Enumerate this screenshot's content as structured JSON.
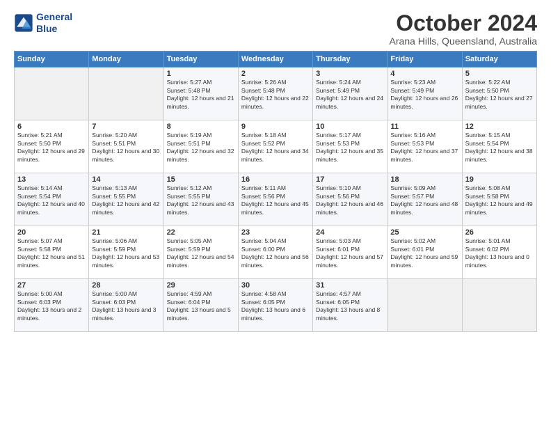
{
  "header": {
    "logo_line1": "General",
    "logo_line2": "Blue",
    "title": "October 2024",
    "subtitle": "Arana Hills, Queensland, Australia"
  },
  "weekdays": [
    "Sunday",
    "Monday",
    "Tuesday",
    "Wednesday",
    "Thursday",
    "Friday",
    "Saturday"
  ],
  "weeks": [
    [
      {
        "day": "",
        "empty": true
      },
      {
        "day": "",
        "empty": true
      },
      {
        "day": "1",
        "sunrise": "5:27 AM",
        "sunset": "5:48 PM",
        "daylight": "12 hours and 21 minutes."
      },
      {
        "day": "2",
        "sunrise": "5:26 AM",
        "sunset": "5:48 PM",
        "daylight": "12 hours and 22 minutes."
      },
      {
        "day": "3",
        "sunrise": "5:24 AM",
        "sunset": "5:49 PM",
        "daylight": "12 hours and 24 minutes."
      },
      {
        "day": "4",
        "sunrise": "5:23 AM",
        "sunset": "5:49 PM",
        "daylight": "12 hours and 26 minutes."
      },
      {
        "day": "5",
        "sunrise": "5:22 AM",
        "sunset": "5:50 PM",
        "daylight": "12 hours and 27 minutes."
      }
    ],
    [
      {
        "day": "6",
        "sunrise": "5:21 AM",
        "sunset": "5:50 PM",
        "daylight": "12 hours and 29 minutes."
      },
      {
        "day": "7",
        "sunrise": "5:20 AM",
        "sunset": "5:51 PM",
        "daylight": "12 hours and 30 minutes."
      },
      {
        "day": "8",
        "sunrise": "5:19 AM",
        "sunset": "5:51 PM",
        "daylight": "12 hours and 32 minutes."
      },
      {
        "day": "9",
        "sunrise": "5:18 AM",
        "sunset": "5:52 PM",
        "daylight": "12 hours and 34 minutes."
      },
      {
        "day": "10",
        "sunrise": "5:17 AM",
        "sunset": "5:53 PM",
        "daylight": "12 hours and 35 minutes."
      },
      {
        "day": "11",
        "sunrise": "5:16 AM",
        "sunset": "5:53 PM",
        "daylight": "12 hours and 37 minutes."
      },
      {
        "day": "12",
        "sunrise": "5:15 AM",
        "sunset": "5:54 PM",
        "daylight": "12 hours and 38 minutes."
      }
    ],
    [
      {
        "day": "13",
        "sunrise": "5:14 AM",
        "sunset": "5:54 PM",
        "daylight": "12 hours and 40 minutes."
      },
      {
        "day": "14",
        "sunrise": "5:13 AM",
        "sunset": "5:55 PM",
        "daylight": "12 hours and 42 minutes."
      },
      {
        "day": "15",
        "sunrise": "5:12 AM",
        "sunset": "5:55 PM",
        "daylight": "12 hours and 43 minutes."
      },
      {
        "day": "16",
        "sunrise": "5:11 AM",
        "sunset": "5:56 PM",
        "daylight": "12 hours and 45 minutes."
      },
      {
        "day": "17",
        "sunrise": "5:10 AM",
        "sunset": "5:56 PM",
        "daylight": "12 hours and 46 minutes."
      },
      {
        "day": "18",
        "sunrise": "5:09 AM",
        "sunset": "5:57 PM",
        "daylight": "12 hours and 48 minutes."
      },
      {
        "day": "19",
        "sunrise": "5:08 AM",
        "sunset": "5:58 PM",
        "daylight": "12 hours and 49 minutes."
      }
    ],
    [
      {
        "day": "20",
        "sunrise": "5:07 AM",
        "sunset": "5:58 PM",
        "daylight": "12 hours and 51 minutes."
      },
      {
        "day": "21",
        "sunrise": "5:06 AM",
        "sunset": "5:59 PM",
        "daylight": "12 hours and 53 minutes."
      },
      {
        "day": "22",
        "sunrise": "5:05 AM",
        "sunset": "5:59 PM",
        "daylight": "12 hours and 54 minutes."
      },
      {
        "day": "23",
        "sunrise": "5:04 AM",
        "sunset": "6:00 PM",
        "daylight": "12 hours and 56 minutes."
      },
      {
        "day": "24",
        "sunrise": "5:03 AM",
        "sunset": "6:01 PM",
        "daylight": "12 hours and 57 minutes."
      },
      {
        "day": "25",
        "sunrise": "5:02 AM",
        "sunset": "6:01 PM",
        "daylight": "12 hours and 59 minutes."
      },
      {
        "day": "26",
        "sunrise": "5:01 AM",
        "sunset": "6:02 PM",
        "daylight": "13 hours and 0 minutes."
      }
    ],
    [
      {
        "day": "27",
        "sunrise": "5:00 AM",
        "sunset": "6:03 PM",
        "daylight": "13 hours and 2 minutes."
      },
      {
        "day": "28",
        "sunrise": "5:00 AM",
        "sunset": "6:03 PM",
        "daylight": "13 hours and 3 minutes."
      },
      {
        "day": "29",
        "sunrise": "4:59 AM",
        "sunset": "6:04 PM",
        "daylight": "13 hours and 5 minutes."
      },
      {
        "day": "30",
        "sunrise": "4:58 AM",
        "sunset": "6:05 PM",
        "daylight": "13 hours and 6 minutes."
      },
      {
        "day": "31",
        "sunrise": "4:57 AM",
        "sunset": "6:05 PM",
        "daylight": "13 hours and 8 minutes."
      },
      {
        "day": "",
        "empty": true
      },
      {
        "day": "",
        "empty": true
      }
    ]
  ],
  "labels": {
    "sunrise": "Sunrise:",
    "sunset": "Sunset:",
    "daylight": "Daylight:"
  }
}
